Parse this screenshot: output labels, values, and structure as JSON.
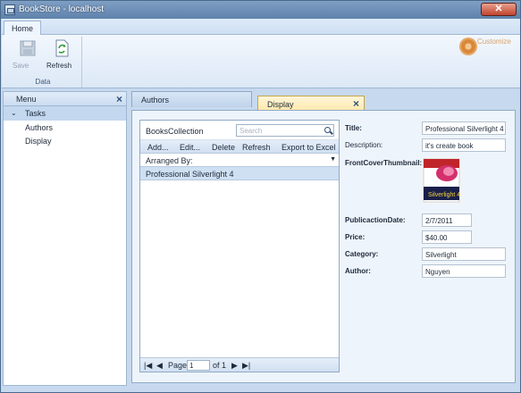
{
  "window": {
    "title": "BookStore - localhost"
  },
  "ribbon": {
    "tab": "Home",
    "group": "Data",
    "save_label": "Save",
    "refresh_label": "Refresh",
    "customize_label": "Customize"
  },
  "menu": {
    "title": "Menu",
    "section": "Tasks",
    "items": [
      {
        "label": "Authors"
      },
      {
        "label": "Display"
      }
    ]
  },
  "tabs": [
    {
      "label": "Authors"
    },
    {
      "label": "Display"
    }
  ],
  "grid": {
    "title": "BooksCollection",
    "search_placeholder": "Search",
    "toolbar": {
      "add": "Add...",
      "edit": "Edit...",
      "delete": "Delete",
      "refresh": "Refresh",
      "export": "Export to Excel"
    },
    "arranged_by": "Arranged By:",
    "rows": [
      "Professional Silverlight 4"
    ],
    "pager": {
      "page_label": "Page",
      "page": "1",
      "of_label": "of 1"
    }
  },
  "details": {
    "title_label": "Title:",
    "title_value": "Professional Silverlight 4",
    "description_label": "Description:",
    "description_value": "it's create book",
    "thumbnail_label": "FrontCoverThumbnail:",
    "thumbnail_text": "Silverlight 4",
    "pubdate_label": "PublicactionDate:",
    "pubdate_value": "2/7/2011",
    "price_label": "Price:",
    "price_value": "$40.00",
    "category_label": "Category:",
    "category_value": "Silverlight",
    "author_label": "Author:",
    "author_value": "Nguyen"
  },
  "colors": {
    "accent": "#c7d9ee",
    "selected_tab": "#ffe7a6"
  }
}
